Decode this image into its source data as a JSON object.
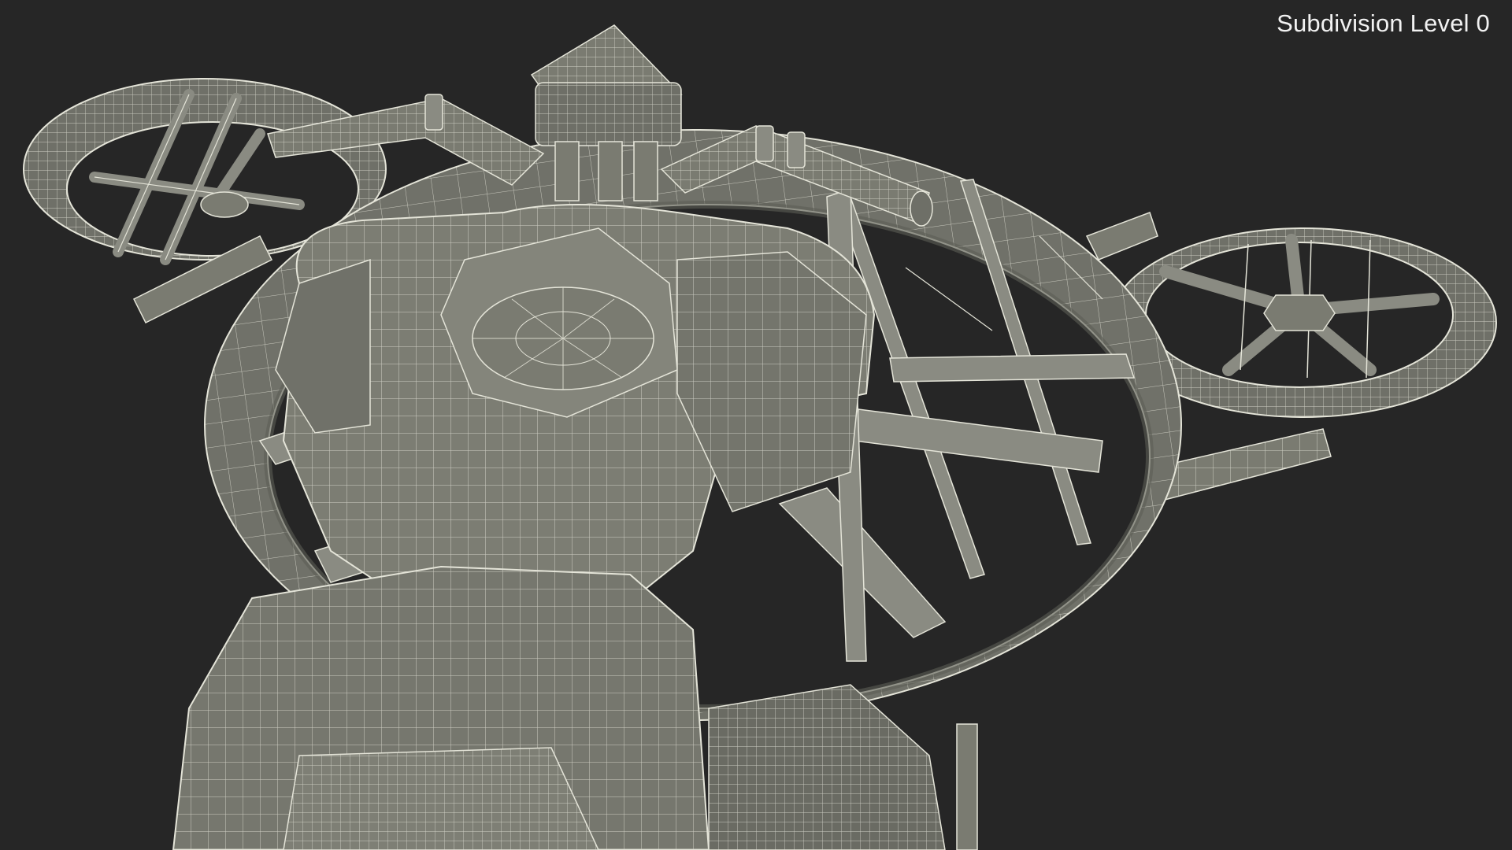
{
  "viewport": {
    "overlay_label": "Subdivision Level 0"
  },
  "render": {
    "subject": "hoverbike-wireframe",
    "background_color": "#262626",
    "surface_color": "#7a7b71",
    "surface_dark_color": "#5c5d55",
    "wire_color": "#e4e4d8"
  }
}
